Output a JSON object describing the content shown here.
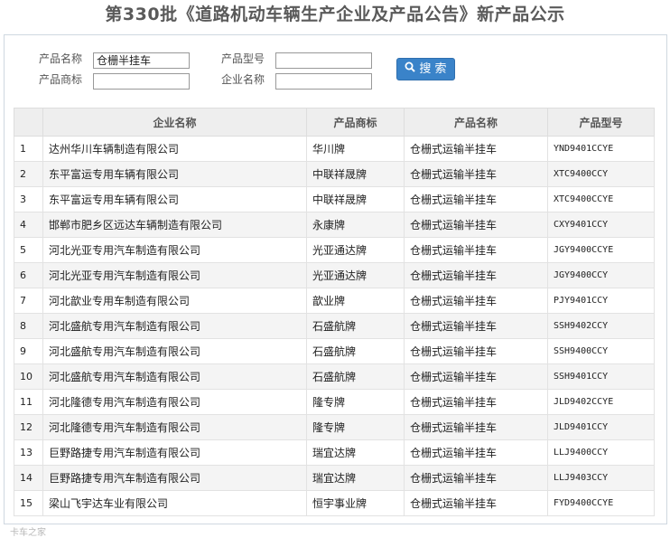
{
  "page": {
    "title": "第330批《道路机动车辆生产企业及产品公告》新产品公示"
  },
  "form": {
    "product_name_label": "产品名称",
    "product_name_value": "仓栅半挂车",
    "product_model_label": "产品型号",
    "product_model_value": "",
    "product_brand_label": "产品商标",
    "product_brand_value": "",
    "company_name_label": "企业名称",
    "company_name_value": "",
    "search_label": "搜 索",
    "search_icon": "search-icon"
  },
  "table": {
    "headers": [
      "",
      "企业名称",
      "产品商标",
      "产品名称",
      "产品型号"
    ],
    "rows": [
      [
        "1",
        "达州华川车辆制造有限公司",
        "华川牌",
        "仓栅式运输半挂车",
        "YND9401CCYE"
      ],
      [
        "2",
        "东平富运专用车辆有限公司",
        "中联祥晟牌",
        "仓栅式运输半挂车",
        "XTC9400CCY"
      ],
      [
        "3",
        "东平富运专用车辆有限公司",
        "中联祥晟牌",
        "仓栅式运输半挂车",
        "XTC9400CCYE"
      ],
      [
        "4",
        "邯郸市肥乡区远达车辆制造有限公司",
        "永康牌",
        "仓栅式运输半挂车",
        "CXY9401CCY"
      ],
      [
        "5",
        "河北光亚专用汽车制造有限公司",
        "光亚通达牌",
        "仓栅式运输半挂车",
        "JGY9400CCYE"
      ],
      [
        "6",
        "河北光亚专用汽车制造有限公司",
        "光亚通达牌",
        "仓栅式运输半挂车",
        "JGY9400CCY"
      ],
      [
        "7",
        "河北歆业专用车制造有限公司",
        "歆业牌",
        "仓栅式运输半挂车",
        "PJY9401CCY"
      ],
      [
        "8",
        "河北盛航专用汽车制造有限公司",
        "石盛航牌",
        "仓栅式运输半挂车",
        "SSH9402CCY"
      ],
      [
        "9",
        "河北盛航专用汽车制造有限公司",
        "石盛航牌",
        "仓栅式运输半挂车",
        "SSH9400CCY"
      ],
      [
        "10",
        "河北盛航专用汽车制造有限公司",
        "石盛航牌",
        "仓栅式运输半挂车",
        "SSH9401CCY"
      ],
      [
        "11",
        "河北隆德专用汽车制造有限公司",
        "隆专牌",
        "仓栅式运输半挂车",
        "JLD9402CCYE"
      ],
      [
        "12",
        "河北隆德专用汽车制造有限公司",
        "隆专牌",
        "仓栅式运输半挂车",
        "JLD9401CCY"
      ],
      [
        "13",
        "巨野路捷专用汽车制造有限公司",
        "瑞宜达牌",
        "仓栅式运输半挂车",
        "LLJ9400CCY"
      ],
      [
        "14",
        "巨野路捷专用汽车制造有限公司",
        "瑞宜达牌",
        "仓栅式运输半挂车",
        "LLJ9403CCY"
      ],
      [
        "15",
        "梁山飞宇达车业有限公司",
        "恒宇事业牌",
        "仓栅式运输半挂车",
        "FYD9400CCYE"
      ]
    ]
  },
  "watermark": "卡车之家"
}
